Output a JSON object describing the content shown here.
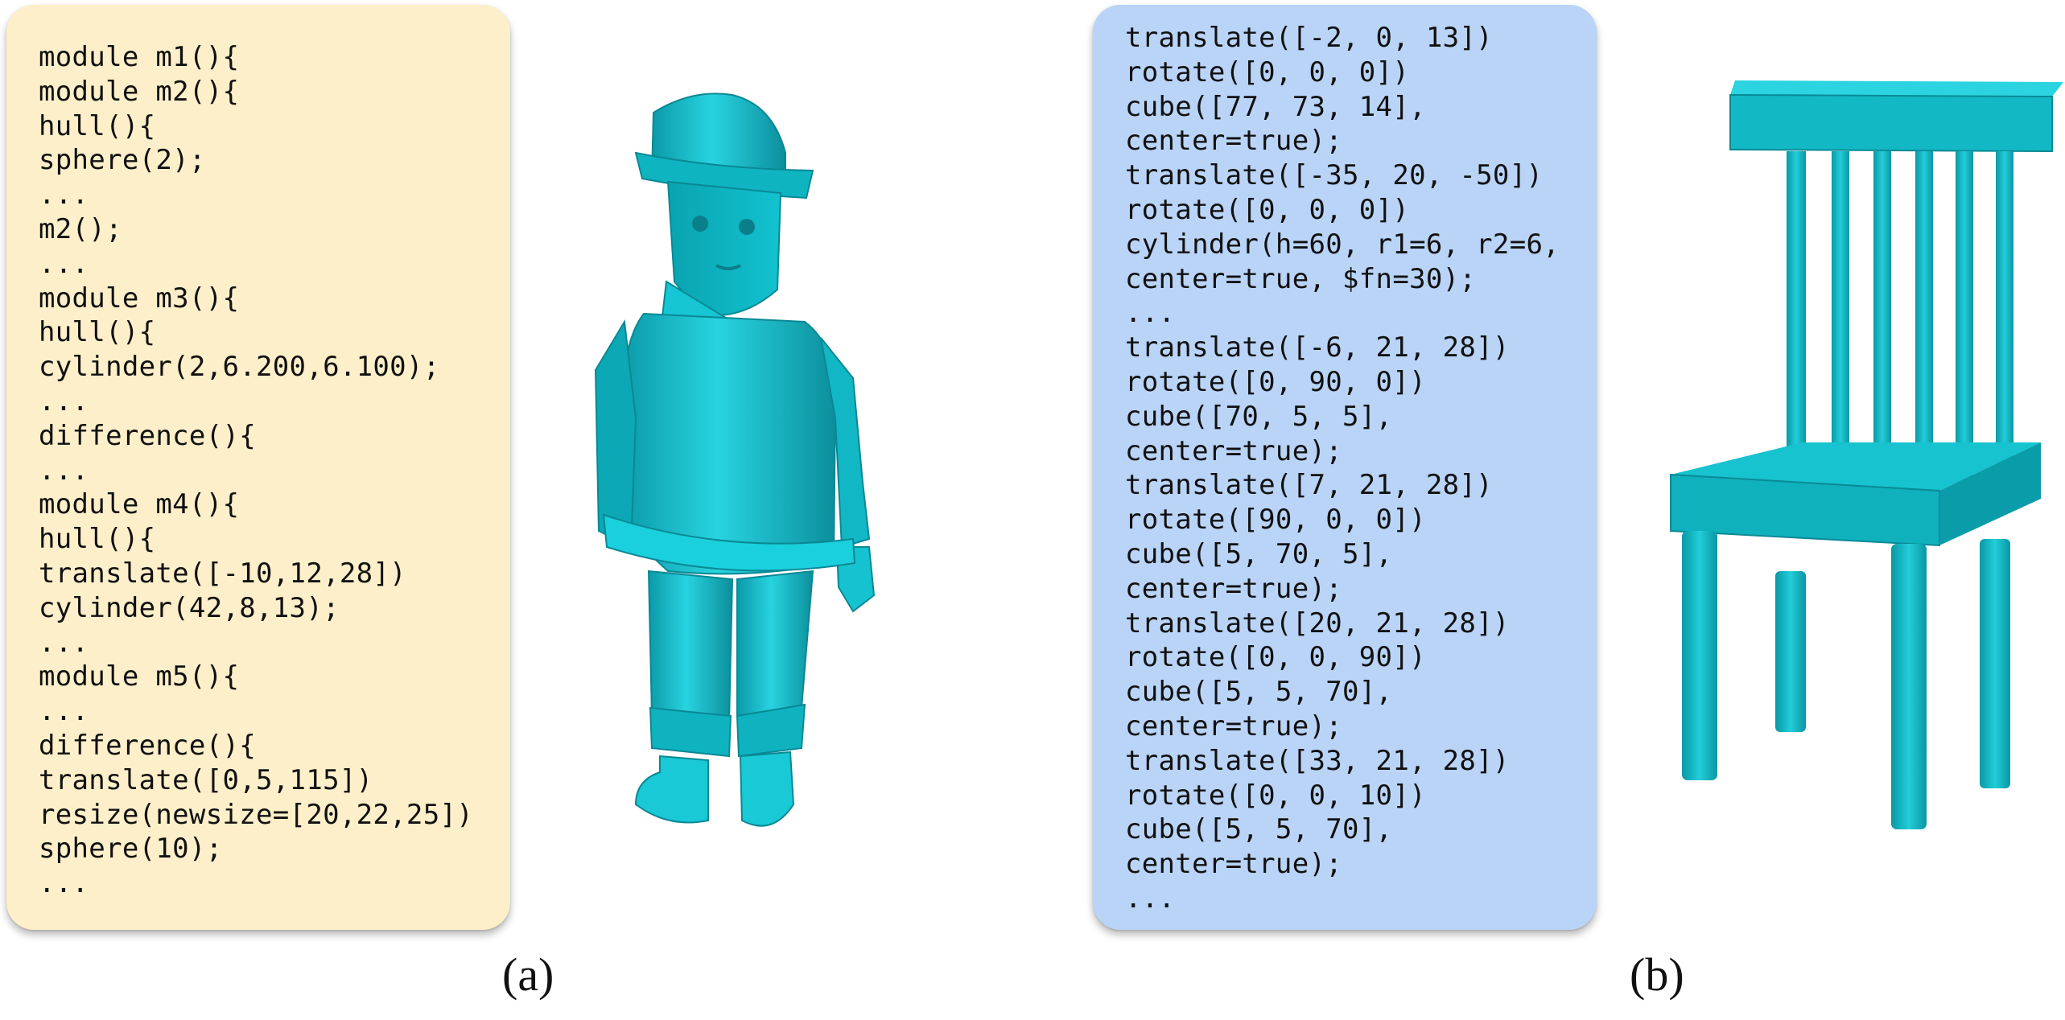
{
  "panel_a": {
    "background": "#fdefc9",
    "code_lines": [
      "module m1(){",
      "module m2(){",
      "hull(){",
      "sphere(2);",
      "...",
      "m2();",
      "...",
      "module m3(){",
      "hull(){",
      "cylinder(2,6.200,6.100);",
      "...",
      "difference(){",
      "...",
      "module m4(){",
      "hull(){",
      "translate([-10,12,28])",
      "cylinder(42,8,13);",
      "...",
      "module m5(){",
      "...",
      "difference(){",
      "translate([0,5,115])",
      "resize(newsize=[20,22,25])",
      "sphere(10);",
      "..."
    ],
    "caption": "(a)"
  },
  "panel_b": {
    "background": "#b9d4f7",
    "code_lines": [
      "translate([-2, 0, 13])",
      "rotate([0, 0, 0])",
      "cube([77, 73, 14],",
      "center=true);",
      "translate([-35, 20, -50])",
      "rotate([0, 0, 0])",
      "cylinder(h=60, r1=6, r2=6,",
      "center=true, $fn=30);",
      "...",
      "translate([-6, 21, 28])",
      "rotate([0, 90, 0])",
      "cube([70, 5, 5],",
      "center=true);",
      "translate([7, 21, 28])",
      "rotate([90, 0, 0])",
      "cube([5, 70, 5],",
      "center=true);",
      "translate([20, 21, 28])",
      "rotate([0, 0, 90])",
      "cube([5, 5, 70],",
      "center=true);",
      "translate([33, 21, 28])",
      "rotate([0, 0, 10])",
      "cube([5, 5, 70],",
      "center=true);",
      "..."
    ],
    "caption": "(b)"
  },
  "model_color": "#1fbfcc"
}
